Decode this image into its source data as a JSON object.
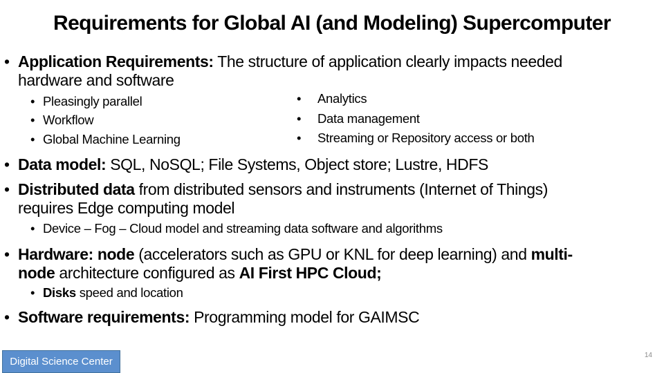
{
  "title": "Requirements for Global AI (and Modeling) Supercomputer",
  "app_req": {
    "bold": "Application Requirements:",
    "text1": " The structure of application clearly impacts needed",
    "text2": "hardware and software",
    "left_items": [
      "Pleasingly parallel",
      "Workflow",
      "Global Machine Learning"
    ],
    "right_items": [
      "Analytics",
      "Data management",
      "Streaming or Repository access or both"
    ]
  },
  "data_model": {
    "bold": "Data model:",
    "text": " SQL, NoSQL; File Systems, Object store; Lustre, HDFS"
  },
  "distributed": {
    "bold": "Distributed data",
    "text1": " from distributed sensors and instruments (Internet of Things)",
    "text2": "requires Edge computing model",
    "sub": "Device – Fog – Cloud model and streaming data software and algorithms"
  },
  "hardware": {
    "bold1": "Hardware: node",
    "text1": " (accelerators such as GPU or KNL for deep learning) and ",
    "bold2": "multi-",
    "bold3": "node",
    "text2": " architecture configured as ",
    "bold4": "AI First HPC Cloud;",
    "sub_bold": "Disks",
    "sub_text": " speed and location"
  },
  "software": {
    "bold": "Software requirements:",
    "text": " Programming model for GAIMSC"
  },
  "footer": {
    "badge": "Digital Science Center",
    "page_number": "14"
  },
  "bullet": "•"
}
